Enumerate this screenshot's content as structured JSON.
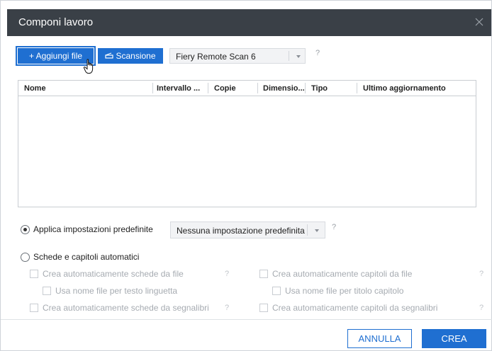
{
  "dialog": {
    "title": "Componi lavoro"
  },
  "toolbar": {
    "add_file_label": "+ Aggiungi file",
    "scan_label": "Scansione",
    "scanner_value": "Fiery Remote Scan 6",
    "help": "?"
  },
  "table": {
    "columns": [
      "Nome",
      "Intervallo ...",
      "Copie",
      "Dimensio...",
      "Tipo",
      "Ultimo aggiornamento"
    ],
    "rows": []
  },
  "presets": {
    "radio_label": "Applica impostazioni predefinite",
    "select_value": "Nessuna impostazione predefinita",
    "help": "?"
  },
  "auto": {
    "radio_label": "Schede e capitoli automatici",
    "tabs_from_files": "Crea automaticamente schede da file",
    "use_filename_tab": "Usa nome file per testo linguetta",
    "tabs_from_bookmarks": "Crea automaticamente schede da segnalibri",
    "chapters_from_files": "Crea automaticamente capitoli da file",
    "use_filename_chapter": "Usa nome file per titolo capitolo",
    "chapters_from_bookmarks": "Crea automaticamente capitoli da segnalibri",
    "help": "?"
  },
  "footer": {
    "cancel_label": "ANNULLA",
    "create_label": "CREA"
  },
  "colors": {
    "accent": "#1f6fd1",
    "titlebar": "#3a4047"
  }
}
